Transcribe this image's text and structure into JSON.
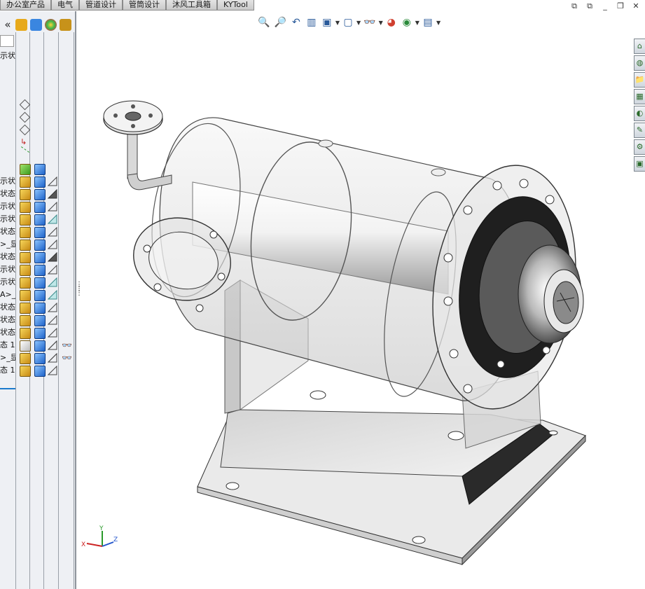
{
  "tabs": [
    "办公室产品",
    "电气",
    "管道设计",
    "管筒设计",
    "沐风工具箱",
    "KYTool"
  ],
  "window_buttons": [
    "⧉",
    "⧉",
    "_",
    "❐",
    "✕"
  ],
  "panel": {
    "collapse_glyph": "«",
    "header_icons": [
      "feature-manager-icon",
      "property-manager-icon",
      "appearance-icon",
      "configuration-manager-icon"
    ],
    "header_colors": [
      "#e7a91b",
      "#3a86e0",
      "#d64040",
      "#c7921a"
    ],
    "partial_label": "示状",
    "rows": [
      "示状",
      "状态",
      "示状",
      "示状",
      "状态",
      ">_显",
      "状态",
      "示状",
      "示状",
      "A>_J",
      "状态",
      "状态",
      "状态",
      "态 1:",
      ">_显",
      "态 1:"
    ]
  },
  "heads_up_toolbar": {
    "buttons": [
      "zoom-to-fit-icon",
      "zoom-area-icon",
      "previous-view-icon",
      "section-view-icon",
      "view-orientation-icon",
      "display-style-icon",
      "hide-show-icon",
      "edit-appearance-icon",
      "apply-scene-icon",
      "view-settings-icon"
    ],
    "glyphs": [
      "🔍",
      "🔎",
      "↶",
      "▥",
      "▣",
      "▢",
      "👓",
      "◕",
      "◉",
      "▤"
    ]
  },
  "task_pane": {
    "buttons": [
      "solidworks-resources-icon",
      "design-library-icon",
      "file-explorer-icon",
      "view-palette-icon",
      "appearances-icon",
      "custom-properties-icon",
      "toolbox-icon",
      "forum-icon"
    ],
    "glyphs": [
      "⌂",
      "◍",
      "📁",
      "▦",
      "◐",
      "✎",
      "⚙",
      "▣"
    ]
  },
  "triad": {
    "x_label": "X",
    "y_label": "Y",
    "z_label": "Z"
  },
  "colors": {
    "accent": "#1a7acc",
    "panel_bg": "#eef0f4",
    "part_icon": "#e7a91b",
    "cube_icon": "#2f7ad6"
  }
}
